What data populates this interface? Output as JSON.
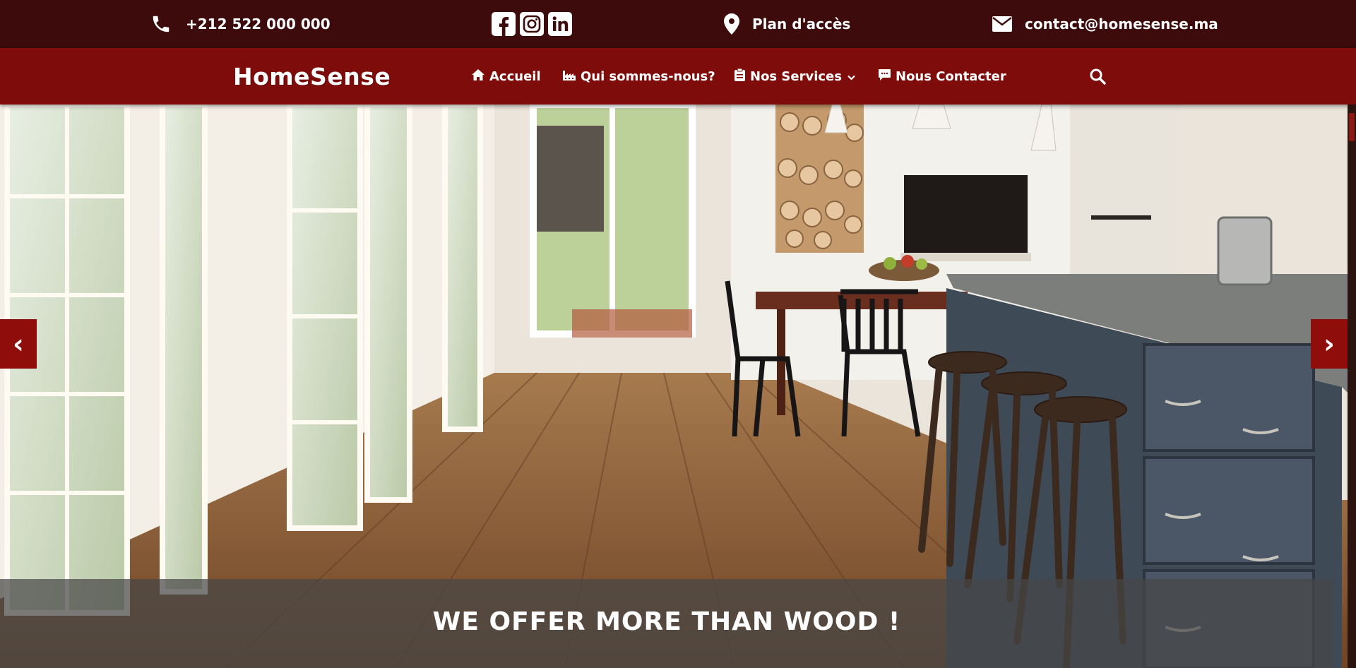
{
  "topbar": {
    "phone": {
      "icon": "phone-icon",
      "text": "+212 522 000 000"
    },
    "social": [
      {
        "icon": "facebook-icon",
        "label": "Facebook"
      },
      {
        "icon": "instagram-icon",
        "label": "Instagram"
      },
      {
        "icon": "linkedin-icon",
        "label": "LinkedIn"
      }
    ],
    "plan": {
      "icon": "map-pin-icon",
      "text": "Plan d'accès"
    },
    "email": {
      "icon": "envelope-icon",
      "text": "contact@homesense.ma"
    }
  },
  "navbar": {
    "logo": "HomeSense",
    "items": [
      {
        "icon": "home-icon",
        "label": "Accueil"
      },
      {
        "icon": "industry-icon",
        "label": "Qui sommes-nous?"
      },
      {
        "icon": "clipboard-icon",
        "label": "Nos Services",
        "has_dropdown": true
      },
      {
        "icon": "comment-icon",
        "label": "Nous Contacter"
      }
    ],
    "search_icon": "search-icon"
  },
  "hero": {
    "prev_label": "‹",
    "next_label": "›",
    "caption": "WE OFFER MORE THAN WOOD !"
  },
  "colors": {
    "topbar_bg": "#3d0b0c",
    "navbar_bg": "#7d0c0b",
    "arrow_bg": "#8f0d0b",
    "caption_bg": "rgba(70,70,70,0.72)",
    "text": "#ffffff"
  }
}
